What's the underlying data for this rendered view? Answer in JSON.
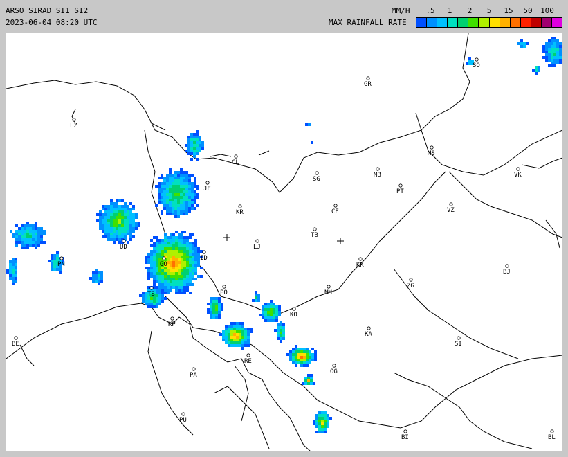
{
  "header": {
    "title": "ARSO SIRAD SI1 SI2",
    "datetime": "2023-06-04 08:20 UTC",
    "unit": "MM/H",
    "legend_title": "MAX RAINFALL RATE"
  },
  "legend": {
    "ticks": [
      ".5",
      "1",
      "2",
      "5",
      "15",
      "50",
      "100"
    ],
    "colors": [
      "#0050ff",
      "#0090ff",
      "#00c0ff",
      "#00e0c0",
      "#00d070",
      "#40e000",
      "#b0f000",
      "#ffe000",
      "#ffb000",
      "#ff7000",
      "#ff2000",
      "#c00000",
      "#a00070",
      "#e000e0"
    ]
  },
  "cities": [
    {
      "code": "SO"
    },
    {
      "code": "GR"
    },
    {
      "code": "LZ"
    },
    {
      "code": "CL"
    },
    {
      "code": "MS"
    },
    {
      "code": "MB"
    },
    {
      "code": "VK"
    },
    {
      "code": "JE"
    },
    {
      "code": "SG"
    },
    {
      "code": "PT"
    },
    {
      "code": "KR"
    },
    {
      "code": "CE"
    },
    {
      "code": "VZ"
    },
    {
      "code": "TB"
    },
    {
      "code": "LJ"
    },
    {
      "code": "ID"
    },
    {
      "code": "KK"
    },
    {
      "code": "BJ"
    },
    {
      "code": "PO"
    },
    {
      "code": "NM"
    },
    {
      "code": "ZG"
    },
    {
      "code": "KO"
    },
    {
      "code": "KP"
    },
    {
      "code": "KA"
    },
    {
      "code": "SI"
    },
    {
      "code": "BE"
    },
    {
      "code": "RE"
    },
    {
      "code": "OG"
    },
    {
      "code": "PA"
    },
    {
      "code": "PU"
    },
    {
      "code": "BI"
    },
    {
      "code": "BL"
    },
    {
      "code": "GO"
    },
    {
      "code": "UD"
    },
    {
      "code": "PN"
    },
    {
      "code": "TS"
    }
  ]
}
